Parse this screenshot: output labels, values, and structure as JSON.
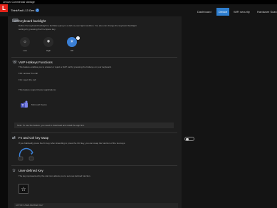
{
  "window": {
    "title": "Lenovo Commercial Vantage"
  },
  "header": {
    "logo_text": "L",
    "product_name": "ThinkPad L13 Gen 2a",
    "nav_tabs": [
      {
        "label": "Dashboard",
        "active": false
      },
      {
        "label": "Device",
        "active": true
      },
      {
        "label": "WiFi security",
        "active": false
      },
      {
        "label": "Hardware Scan",
        "active": false
      }
    ]
  },
  "keyboard_backlight": {
    "title": "Keyboard backlight",
    "description_1": "Define the keyboard backlight to facilitate typing in a dark or poor light condition. You also can change the keyboard backlight",
    "description_2": "settings by pressing the Fn+Space key.",
    "options": [
      {
        "label": "Low",
        "selected": false
      },
      {
        "label": "High",
        "selected": false
      },
      {
        "label": "Off",
        "selected": true
      }
    ]
  },
  "voip": {
    "title": "VoIP Hotkeys Functions",
    "description": "This feature enables you to answer or reject a VoIP call by pressing the hotkeys on your keyboard.",
    "f10": "F10: answer the call",
    "f11": "F11: reject the call",
    "supported": "This feature support below applications:",
    "app_name": "Microsoft Teams",
    "note": "Note: To use the feature, you need to download and install the app first."
  },
  "fn_ctrl": {
    "title": "Fn and Ctrl key swap",
    "description": "If you habitually press the Fn key when intending to press the Ctrl key, you can swap the function of the two keys.",
    "enabled": false
  },
  "user_defined": {
    "title": "User-defined Key",
    "description": "The key represented by the star icon allows you to set user-defined function.",
    "action_header": "ACTION USER-DEFINED KEY"
  },
  "colors": {
    "accent": "#2f7fd0",
    "brand": "#e2231a",
    "background": "#1e1e1e"
  }
}
